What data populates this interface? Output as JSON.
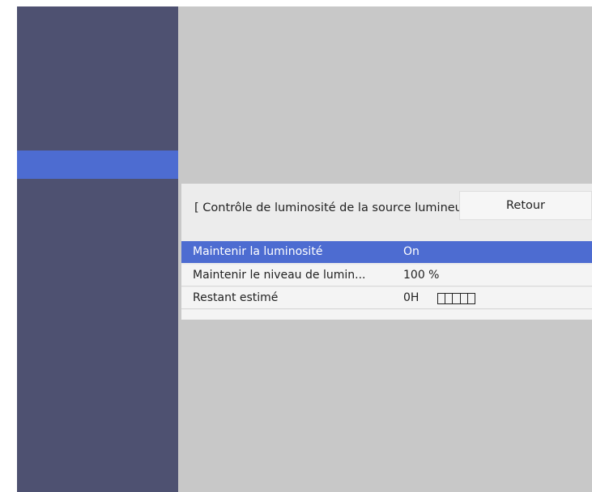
{
  "panel": {
    "title": "[ Contrôle de luminosité de la source lumineu",
    "back_label": "Retour"
  },
  "rows": [
    {
      "label": "Maintenir la luminosité",
      "value": "On"
    },
    {
      "label": "Maintenir le niveau de lumin...",
      "value": "100 %"
    },
    {
      "label": "Restant estimé",
      "value": "0H"
    }
  ],
  "gauge": {
    "segments": 5,
    "filled_fraction": 0
  },
  "colors": {
    "sidebar": "#4e5171",
    "accent": "#4d6cd1",
    "background": "#c8c8c8",
    "panel": "#ececec"
  }
}
